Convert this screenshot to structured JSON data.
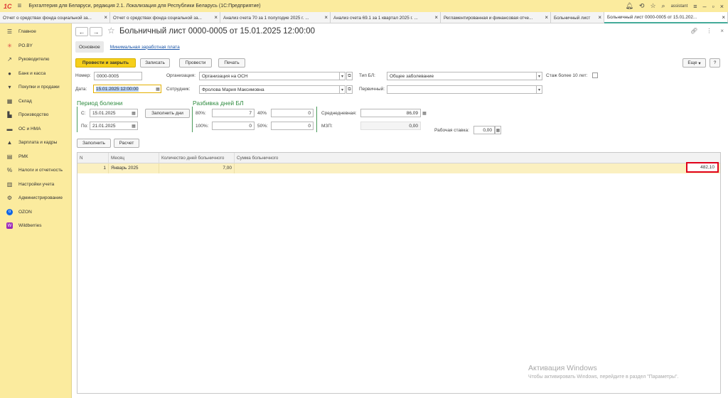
{
  "app": {
    "logo": "1С",
    "title": "Бухгалтерия для Беларуси, редакция 2.1. Локализация для Республики Беларусь  (1С:Предприятие)",
    "user": "assistant"
  },
  "tabs": [
    {
      "label": "Отчет о средствах фонда социальной за..."
    },
    {
      "label": "Отчет о средствах фонда социальной за..."
    },
    {
      "label": "Анализ счета 70 за 1 полугодие 2025 г. ..."
    },
    {
      "label": "Анализ счета 69.1 за 1 квартал 2025 г. ..."
    },
    {
      "label": "Регламентированная и финансовая отче..."
    },
    {
      "label": "Больничный лист"
    },
    {
      "label": "Больничный лист 0000-0005 от 15.01.202..."
    }
  ],
  "sidebar": {
    "items": [
      {
        "label": "Главное",
        "icon": "menu-icon"
      },
      {
        "label": "PO.BY",
        "icon": "sparkle-icon"
      },
      {
        "label": "Руководителю",
        "icon": "trend-icon"
      },
      {
        "label": "Банк и касса",
        "icon": "bank-icon"
      },
      {
        "label": "Покупки и продажи",
        "icon": "cart-icon"
      },
      {
        "label": "Склад",
        "icon": "warehouse-icon"
      },
      {
        "label": "Производство",
        "icon": "factory-icon"
      },
      {
        "label": "ОС и НМА",
        "icon": "truck-icon"
      },
      {
        "label": "Зарплата и кадры",
        "icon": "person-icon"
      },
      {
        "label": "РМК",
        "icon": "register-icon"
      },
      {
        "label": "Налоги и отчетность",
        "icon": "percent-icon"
      },
      {
        "label": "Настройки учета",
        "icon": "settings-doc-icon"
      },
      {
        "label": "Администрирование",
        "icon": "gear-icon"
      },
      {
        "label": "OZON",
        "icon": "ozon-icon"
      },
      {
        "label": "Wildberries",
        "icon": "wildberries-icon"
      }
    ]
  },
  "doc": {
    "title": "Больничный лист 0000-0005 от 15.01.2025 12:00:00",
    "subtabs": {
      "main": "Основное",
      "link": "Минимальная заработная плата"
    },
    "toolbar": {
      "post_close": "Провести и закрыть",
      "save": "Записать",
      "post": "Провести",
      "print": "Печать",
      "more": "Еще",
      "help": "?"
    },
    "fields": {
      "number_label": "Номер:",
      "number": "0000-0005",
      "date_label": "Дата:",
      "date": "15.01.2025 12:00:00",
      "org_label": "Организация:",
      "org": "Организация на ОСН",
      "employee_label": "Сотрудник:",
      "employee": "Фролова Мария Максимовна",
      "type_label": "Тип БЛ:",
      "type": "Общее заболевание",
      "primary_label": "Первичный:",
      "primary": "",
      "stazh_label": "Стаж более 10 лет:"
    },
    "period": {
      "title": "Период болезни",
      "from_label": "С:",
      "from": "15.01.2025",
      "to_label": "По:",
      "to": "21.01.2025",
      "fill_days": "Заполнить дни"
    },
    "breakdown": {
      "title": "Разбивка дней БЛ",
      "p80_label": "80%:",
      "p80": "7",
      "p40_label": "40%",
      "p40": "0",
      "p100_label": "100%:",
      "p100": "0",
      "p50_label": "50%:",
      "p50": "0",
      "avg_label": "Среднедневная:",
      "avg": "86,09",
      "mzp_label": "МЗП:",
      "mzp": "0,00",
      "rate_label": "Рабочая ставка:",
      "rate": "0,00"
    },
    "actions": {
      "fill": "Заполнить",
      "calc": "Расчет"
    },
    "table": {
      "headers": [
        "N",
        "Месяц",
        "Количество дней больничного",
        "Сумма больничного"
      ],
      "rows": [
        {
          "n": "1",
          "month": "Январь 2025",
          "days": "7,00",
          "sum": "482,10"
        }
      ]
    }
  },
  "watermark": {
    "line1": "Активация Windows",
    "line2": "Чтобы активировать Windows, перейдите в раздел \"Параметры\"."
  }
}
